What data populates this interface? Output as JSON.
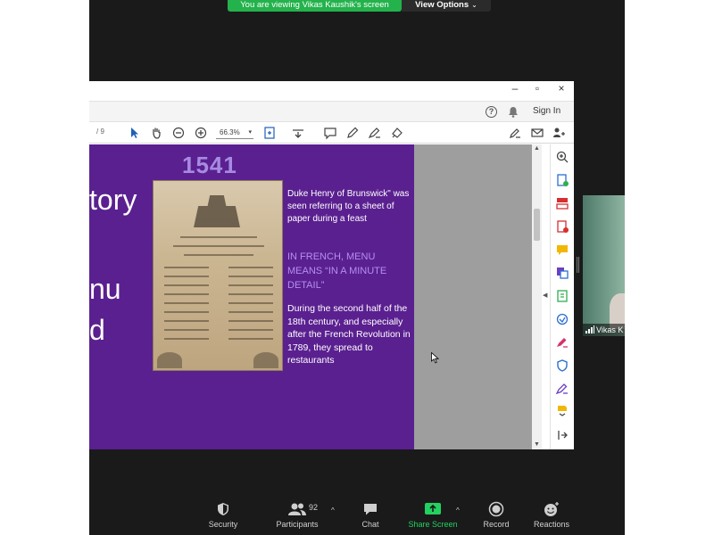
{
  "share_banner": {
    "viewing_text": "You are viewing Vikas Kaushik's screen",
    "view_options_label": "View Options"
  },
  "window": {
    "controls": {
      "minimize": "–",
      "maximize": "▫",
      "close": "×"
    },
    "menu": {
      "sign_in_label": "Sign In"
    },
    "toolbar": {
      "page_count": "/ 9",
      "zoom_level": "66.3%"
    }
  },
  "slide": {
    "left_words": [
      "tory",
      "nu",
      "d"
    ],
    "year": "1541",
    "text_1": "Duke Henry of Brunswick\" was seen referring to a sheet of paper during a feast",
    "text_2": "IN FRENCH, MENU MEANS “IN A MINUTE DETAIL”",
    "text_3": "During the second half of the 18th century, and especially after the French Revolution in 1789, they spread to restaurants"
  },
  "participant": {
    "name": "Vikas K"
  },
  "zoom_toolbar": {
    "security_label": "Security",
    "participants_label": "Participants",
    "participants_count": "92",
    "chat_label": "Chat",
    "share_screen_label": "Share Screen",
    "record_label": "Record",
    "reactions_label": "Reactions"
  },
  "colors": {
    "zoom_background": "#1a1a1a",
    "share_banner": "#23b24b",
    "slide_purple": "#5a2090",
    "slide_year": "#a78be0",
    "slide_highlight_text": "#b58ef0",
    "doc_gray": "#9e9e9e",
    "share_screen_accent": "#23d160"
  },
  "icons": {
    "right_pane": [
      "zoom-in-icon",
      "export-pdf-icon",
      "organize-pages-icon",
      "create-pdf-icon",
      "comment-icon",
      "combine-files-icon",
      "edit-pdf-icon",
      "send-for-review-icon",
      "fill-sign-icon",
      "protect-icon",
      "sign-icon",
      "more-tools-icon",
      "expand-pane-icon"
    ]
  }
}
